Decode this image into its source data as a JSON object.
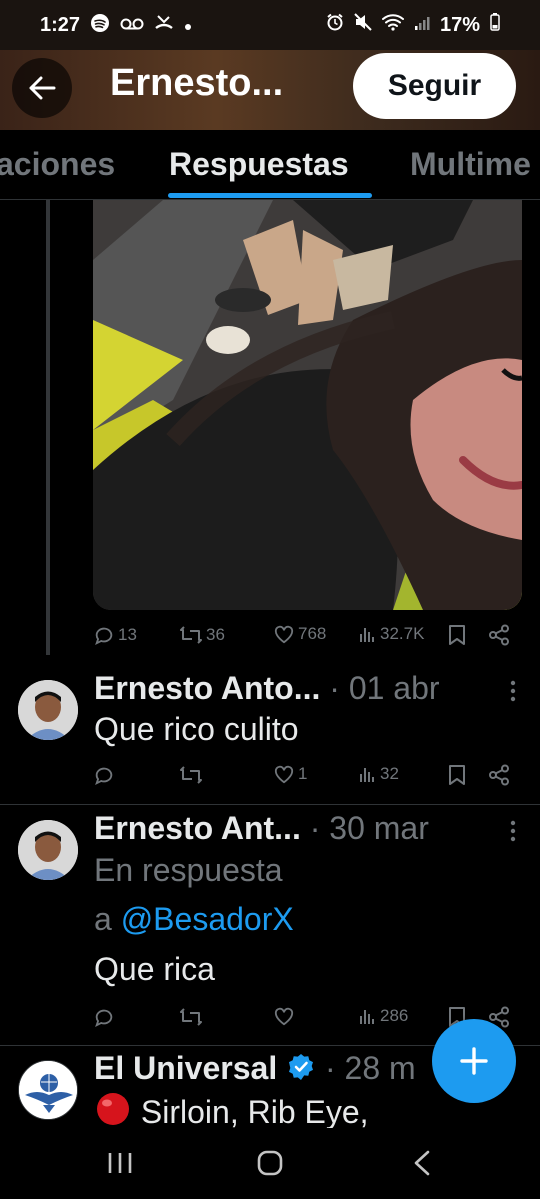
{
  "status_bar": {
    "time": "1:27",
    "battery": "17%",
    "left_icons": [
      "spotify-icon",
      "voicemail-icon",
      "missed-call-icon",
      "dot-icon"
    ],
    "right_icons": [
      "alarm-icon",
      "mute-icon",
      "wifi-icon",
      "signal-icon",
      "battery-icon"
    ]
  },
  "header": {
    "back_icon": "arrow-left-icon",
    "title": "Ernesto...",
    "follow_label": "Seguir"
  },
  "tabs": [
    {
      "label": "aciones",
      "active": false
    },
    {
      "label": "Respuestas",
      "active": true
    },
    {
      "label": "Multime",
      "active": false
    }
  ],
  "colors": {
    "accent": "#1d9bf0",
    "text": "#e7e9ea",
    "muted": "#71767b",
    "divider": "#2f3336",
    "verified": "#1d9bf0"
  },
  "original_tweet": {
    "image": "selfie-photo",
    "actions": {
      "replies": "13",
      "retweets": "36",
      "likes": "768",
      "views": "32.7K"
    }
  },
  "replies": [
    {
      "name": "Ernesto Anto...",
      "date": "· 01 abr",
      "text": "Que rico culito",
      "actions": {
        "replies": "",
        "retweets": "",
        "likes": "1",
        "views": "32"
      }
    },
    {
      "name": "Ernesto Ant...",
      "date": "· 30 mar",
      "reply_prefix": "En respuesta",
      "reply_to_prefix": "a ",
      "reply_to": "@BesadorX",
      "text": "Que rica",
      "actions": {
        "replies": "",
        "retweets": "",
        "likes": "",
        "views": "286"
      }
    }
  ],
  "next_tweet": {
    "name": "El Universal",
    "date": "· 28 m",
    "text": "Sirloin, Rib Eye,",
    "bullet_icon": "red-circle-icon",
    "verified_icon": "verified-badge-icon"
  },
  "fab": {
    "icon": "plus-icon"
  },
  "nav": [
    "recents-icon",
    "home-icon",
    "back-icon"
  ]
}
